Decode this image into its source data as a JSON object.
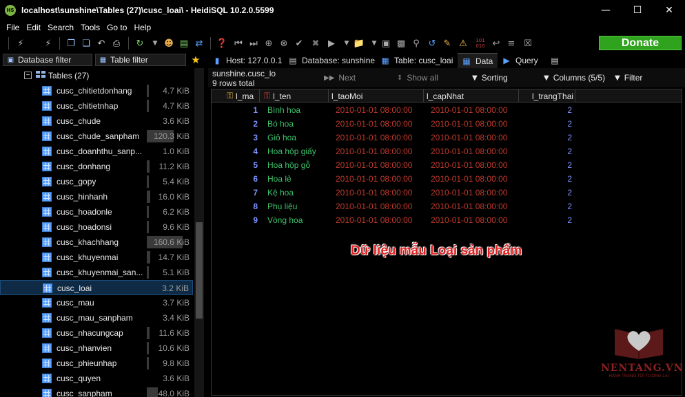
{
  "window": {
    "app_icon_text": "HS",
    "title": "localhost\\sunshine\\Tables (27)\\cusc_loai\\ - HeidiSQL 10.2.0.5599",
    "minimize": "—",
    "maximize": "☐",
    "close": "✕"
  },
  "menu": [
    "File",
    "Edit",
    "Search",
    "Tools",
    "Go to",
    "Help"
  ],
  "toolbar": {
    "donate_label": "Donate"
  },
  "left_panel": {
    "database_filter_label": "Database filter",
    "table_filter_label": "Table filter",
    "folder": {
      "label": "Tables (27)",
      "expander": "−"
    },
    "tables": [
      {
        "name": "cusc_chitietdonhang",
        "size": "4.7 KiB",
        "bar": 0.02
      },
      {
        "name": "cusc_chitietnhap",
        "size": "4.7 KiB",
        "bar": 0.02
      },
      {
        "name": "cusc_chude",
        "size": "3.6 KiB",
        "bar": 0.0
      },
      {
        "name": "cusc_chude_sanpham",
        "size": "120.3 KiB",
        "bar": 0.75
      },
      {
        "name": "cusc_doanhthu_sanp...",
        "size": "1.0 KiB",
        "bar": 0.0
      },
      {
        "name": "cusc_donhang",
        "size": "11.2 KiB",
        "bar": 0.07
      },
      {
        "name": "cusc_gopy",
        "size": "5.4 KiB",
        "bar": 0.02
      },
      {
        "name": "cusc_hinhanh",
        "size": "16.0 KiB",
        "bar": 0.1
      },
      {
        "name": "cusc_hoadonle",
        "size": "6.2 KiB",
        "bar": 0.04
      },
      {
        "name": "cusc_hoadonsi",
        "size": "9.6 KiB",
        "bar": 0.06
      },
      {
        "name": "cusc_khachhang",
        "size": "160.6 KiB",
        "bar": 1.0
      },
      {
        "name": "cusc_khuyenmai",
        "size": "14.7 KiB",
        "bar": 0.09
      },
      {
        "name": "cusc_khuyenmai_san...",
        "size": "5.1 KiB",
        "bar": 0.02
      },
      {
        "name": "cusc_loai",
        "size": "3.2 KiB",
        "bar": 0.0,
        "selected": true
      },
      {
        "name": "cusc_mau",
        "size": "3.7 KiB",
        "bar": 0.0
      },
      {
        "name": "cusc_mau_sanpham",
        "size": "3.4 KiB",
        "bar": 0.0
      },
      {
        "name": "cusc_nhacungcap",
        "size": "11.6 KiB",
        "bar": 0.07
      },
      {
        "name": "cusc_nhanvien",
        "size": "10.6 KiB",
        "bar": 0.06
      },
      {
        "name": "cusc_phieunhap",
        "size": "9.8 KiB",
        "bar": 0.06
      },
      {
        "name": "cusc_quyen",
        "size": "3.6 KiB",
        "bar": 0.0
      },
      {
        "name": "cusc_sanpham",
        "size": "48.0 KiB",
        "bar": 0.3
      }
    ]
  },
  "tabs": {
    "host": "Host: 127.0.0.1",
    "database": "Database: sunshine",
    "table": "Table: cusc_loai",
    "data": "Data",
    "query": "Query"
  },
  "data_toolbar": {
    "table_name": "sunshine.cusc_lo",
    "rows_total": "9 rows total",
    "next": "Next",
    "show_all": "Show all",
    "sorting": "Sorting",
    "columns": "Columns (5/5)",
    "filter": "Filter"
  },
  "grid": {
    "columns": [
      "l_ma",
      "l_ten",
      "l_taoMoi",
      "l_capNhat",
      "l_trangThai"
    ],
    "rows": [
      [
        "1",
        "Bình hoa",
        "2010-01-01 08:00:00",
        "2010-01-01 08:00:00",
        "2"
      ],
      [
        "2",
        "Bó hoa",
        "2010-01-01 08:00:00",
        "2010-01-01 08:00:00",
        "2"
      ],
      [
        "3",
        "Giỏ hoa",
        "2010-01-01 08:00:00",
        "2010-01-01 08:00:00",
        "2"
      ],
      [
        "4",
        "Hoa hộp giấy",
        "2010-01-01 08:00:00",
        "2010-01-01 08:00:00",
        "2"
      ],
      [
        "5",
        "Hoa hộp gỗ",
        "2010-01-01 08:00:00",
        "2010-01-01 08:00:00",
        "2"
      ],
      [
        "6",
        "Hoa lẻ",
        "2010-01-01 08:00:00",
        "2010-01-01 08:00:00",
        "2"
      ],
      [
        "7",
        "Kệ hoa",
        "2010-01-01 08:00:00",
        "2010-01-01 08:00:00",
        "2"
      ],
      [
        "8",
        "Phụ liệu",
        "2010-01-01 08:00:00",
        "2010-01-01 08:00:00",
        "2"
      ],
      [
        "9",
        "Vòng hoa",
        "2010-01-01 08:00:00",
        "2010-01-01 08:00:00",
        "2"
      ]
    ]
  },
  "annotation": "Dữ liệu mẫu Loại sản phẩm",
  "watermark": {
    "brand": "NENTANG.VN",
    "tagline": "HÀNH TRANG TỚI TƯƠNG LAI"
  },
  "colors": {
    "id_number": "#7f93ff",
    "text_value": "#3ec46d",
    "datetime_value": "#c0392b",
    "donate_green": "#2fa31e",
    "selection": "#0f2a45"
  }
}
